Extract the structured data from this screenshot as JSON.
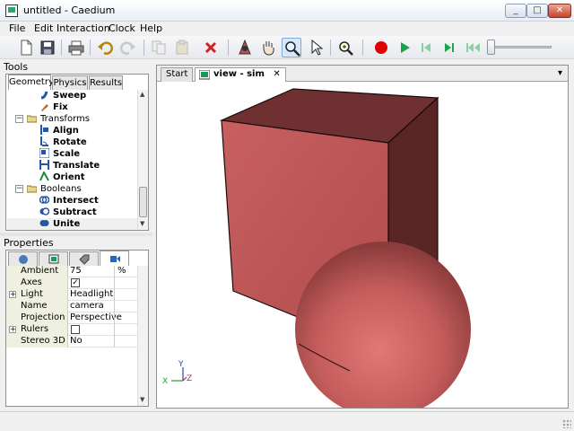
{
  "window": {
    "title": "untitled - Caedium",
    "minimize": "_",
    "maximize": "□",
    "close": "✕"
  },
  "menu": [
    "File",
    "Edit",
    "Interaction",
    "Clock",
    "Help"
  ],
  "toolbar": {
    "icons": [
      "new-file-icon",
      "save-icon",
      "print-icon",
      "undo-icon",
      "redo-icon",
      "copy-icon",
      "paste-icon",
      "delete-icon",
      "orbit-icon",
      "pan-icon",
      "zoom-icon",
      "select-icon",
      "zoom-fit-icon",
      "record-icon",
      "play-icon",
      "step-back-icon",
      "step-forward-icon",
      "rewind-icon"
    ],
    "slider_value": 0
  },
  "tools": {
    "title": "Tools",
    "tabs": [
      "Geometry",
      "Physics",
      "Results"
    ],
    "selected_tab": "Geometry",
    "tree": [
      {
        "label": "Sweep",
        "bold": true,
        "icon": "sweep-icon"
      },
      {
        "label": "Fix",
        "bold": true,
        "icon": "fix-icon"
      },
      {
        "label": "Transforms",
        "bold": false,
        "icon": "folder-icon",
        "expander": "⊟"
      },
      {
        "label": "Align",
        "bold": true,
        "icon": "align-icon"
      },
      {
        "label": "Rotate",
        "bold": true,
        "icon": "rotate-icon"
      },
      {
        "label": "Scale",
        "bold": true,
        "icon": "scale-icon"
      },
      {
        "label": "Translate",
        "bold": true,
        "icon": "translate-icon"
      },
      {
        "label": "Orient",
        "bold": true,
        "icon": "orient-icon"
      },
      {
        "label": "Booleans",
        "bold": false,
        "icon": "folder-icon",
        "expander": "⊟"
      },
      {
        "label": "Intersect",
        "bold": true,
        "icon": "intersect-icon"
      },
      {
        "label": "Subtract",
        "bold": true,
        "icon": "subtract-icon"
      },
      {
        "label": "Unite",
        "bold": true,
        "icon": "unite-icon",
        "selected": true
      }
    ]
  },
  "properties": {
    "title": "Properties",
    "tabs": [
      "sphere-icon",
      "display-icon",
      "tag-icon",
      "camera-icon"
    ],
    "selected_tab": "camera-icon",
    "rows": [
      {
        "key": "Ambient",
        "value": "75",
        "unit": "%"
      },
      {
        "key": "Axes",
        "value": "",
        "checkbox": true,
        "checked": true
      },
      {
        "key": "Light",
        "value": "Headlight",
        "expandable": true
      },
      {
        "key": "Name",
        "value": "camera"
      },
      {
        "key": "Projection",
        "value": "Perspective"
      },
      {
        "key": "Rulers",
        "value": "",
        "checkbox": true,
        "checked": false,
        "expandable": true
      },
      {
        "key": "Stereo 3D",
        "value": "No"
      }
    ]
  },
  "view": {
    "tabs": [
      {
        "label": "Start",
        "selected": false
      },
      {
        "label": "view - sim",
        "selected": true,
        "closable": true
      }
    ],
    "dropdown": "▾",
    "axes": {
      "y": "Y",
      "x": "X",
      "z": "Z"
    },
    "colors": {
      "box_front": "#c55a5a",
      "box_top": "#6e3030",
      "box_side": "#5a2525",
      "sphere_light": "#e07878",
      "sphere_dark": "#8c3c3c"
    }
  }
}
